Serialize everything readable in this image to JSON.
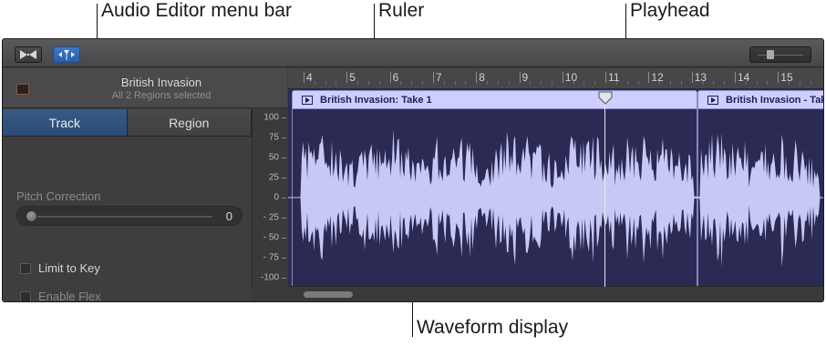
{
  "callouts": {
    "menu_bar": "Audio Editor menu bar",
    "ruler": "Ruler",
    "playhead": "Playhead",
    "waveform": "Waveform display"
  },
  "menubar": {
    "buttons": [
      "catch-icon",
      "flex-icon"
    ],
    "zoom_slider_icon": "zoom-slider-icon"
  },
  "inspector": {
    "track_name": "British Invasion",
    "subtitle": "All 2 Regions selected",
    "tabs": [
      {
        "label": "Track",
        "selected": true
      },
      {
        "label": "Region",
        "selected": false
      }
    ],
    "pitch_correction": {
      "label": "Pitch Correction",
      "value": "0"
    },
    "limit_to_key": {
      "label": "Limit to Key",
      "checked": false
    },
    "enable_flex": {
      "label": "Enable Flex",
      "checked": false
    }
  },
  "y_axis": {
    "ticks": [
      "100",
      "75",
      "50",
      "25",
      "0",
      "- 25",
      "- 50",
      "- 75",
      "-100"
    ]
  },
  "ruler": {
    "bars": [
      "4",
      "5",
      "6",
      "7",
      "8",
      "9",
      "10",
      "11",
      "12",
      "13",
      "14",
      "15"
    ]
  },
  "regions": [
    {
      "title": "British Invasion: Take 1"
    },
    {
      "title": "British Invasion - Take"
    }
  ],
  "playhead": {
    "bar": 11
  },
  "colors": {
    "region_header": "#cfcfff",
    "region_body": "#2a2a55",
    "waveform": "#c8c8f4",
    "track_tab": "#365a86"
  }
}
